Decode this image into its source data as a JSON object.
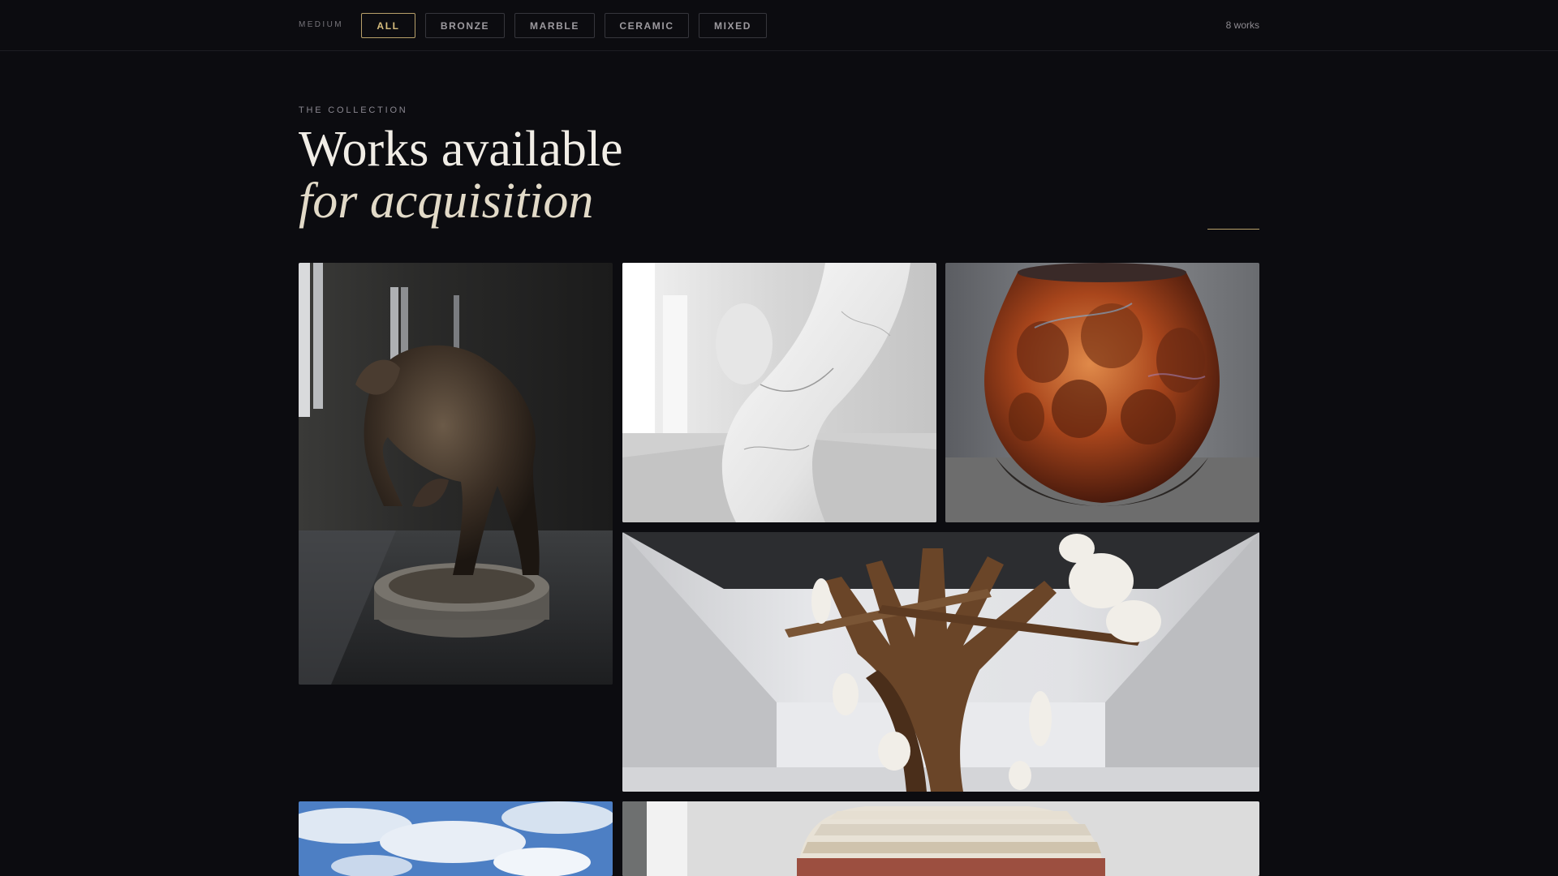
{
  "filters": {
    "label": "MEDIUM",
    "items": [
      {
        "label": "ALL",
        "active": true
      },
      {
        "label": "BRONZE",
        "active": false
      },
      {
        "label": "MARBLE",
        "active": false
      },
      {
        "label": "CERAMIC",
        "active": false
      },
      {
        "label": "MIXED",
        "active": false
      }
    ],
    "count": "8 works"
  },
  "header": {
    "eyebrow": "THE COLLECTION",
    "title_line1": "Works available",
    "title_line2": "for acquisition"
  },
  "colors": {
    "background": "#0c0c10",
    "accent": "#b8a06a",
    "text": "#f1ede6"
  },
  "gallery": {
    "works": [
      {
        "medium": "bronze",
        "image": "bronze-crouching-figure"
      },
      {
        "medium": "marble",
        "image": "white-marble-spiral"
      },
      {
        "medium": "ceramic",
        "image": "copper-raku-vessel"
      },
      {
        "medium": "mixed",
        "image": "timber-and-porcelain-figures-installation"
      },
      {
        "medium": "unknown",
        "image": "sky-landscape"
      },
      {
        "medium": "ceramic",
        "image": "layered-clay-form"
      }
    ]
  }
}
